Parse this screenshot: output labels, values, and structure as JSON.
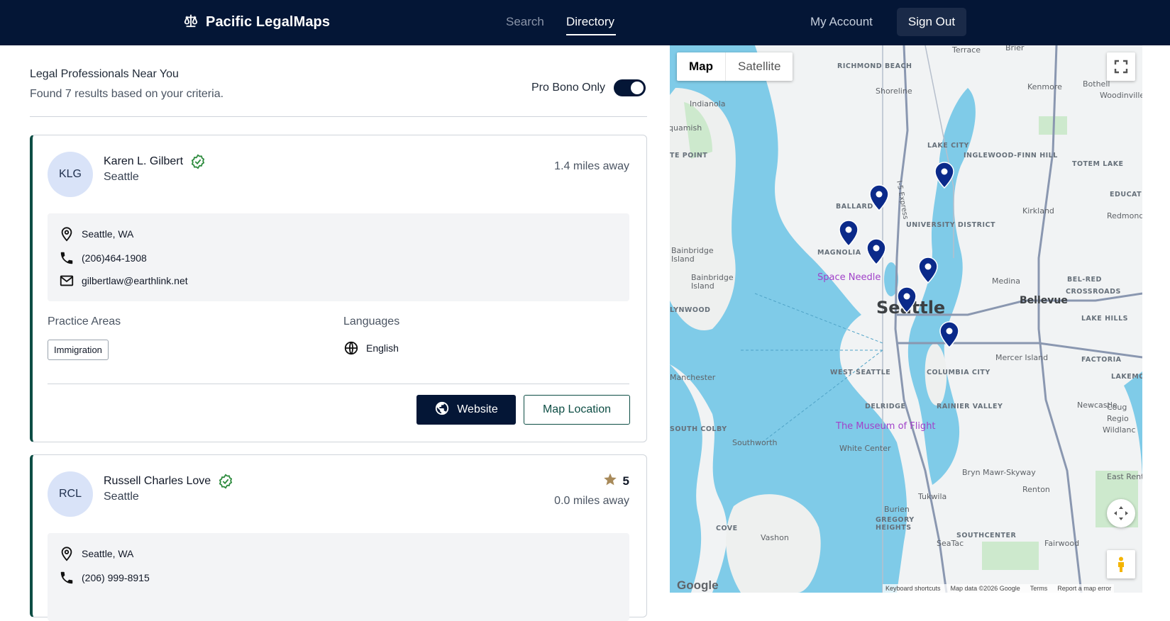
{
  "app": {
    "brand": "Pacific LegalMaps"
  },
  "nav": {
    "search": "Search",
    "directory": "Directory",
    "account": "My Account",
    "sign_out": "Sign Out"
  },
  "results": {
    "title": "Legal Professionals Near You",
    "summary": "Found 7 results based on your criteria.",
    "pro_bono_label": "Pro Bono Only",
    "pro_bono_on": true
  },
  "labels": {
    "practice_areas": "Practice Areas",
    "languages": "Languages",
    "website": "Website",
    "map_location": "Map Location"
  },
  "lawyers": [
    {
      "initials": "KLG",
      "name": "Karen L. Gilbert",
      "city": "Seattle",
      "verified": true,
      "distance": "1.4 miles away",
      "address": "Seattle, WA",
      "phone": "(206)464-1908",
      "email": "gilbertlaw@earthlink.net",
      "practice_areas": [
        "Immigration"
      ],
      "languages": [
        "English"
      ]
    },
    {
      "initials": "RCL",
      "name": "Russell Charles Love",
      "city": "Seattle",
      "verified": true,
      "rating": "5",
      "distance": "0.0 miles away",
      "address": "Seattle, WA",
      "phone": "(206) 999-8915"
    }
  ],
  "map": {
    "type_map": "Map",
    "type_satellite": "Satellite",
    "city_label": "Seattle",
    "labels": {
      "bellevue": "Bellevue",
      "kirkland": "Kirkland",
      "redmond": "Redmond",
      "medina": "Medina",
      "shoreline": "Shoreline",
      "kenmore": "Kenmore",
      "bothell": "Bothell",
      "woodinville": "Woodinville",
      "richmond_beach": "RICHMOND BEACH",
      "brier": "Brier",
      "terrace": "Terrace",
      "indianola": "Indianola",
      "suquamish": "quamish",
      "te_point": "TE POINT",
      "lake_city": "LAKE CITY",
      "inglewood": "INGLEWOOD-FINN HILL",
      "totem_lake": "TOTEM LAKE",
      "education": "EDUCATION",
      "ballard": "BALLARD",
      "university_district": "UNIVERSITY DISTRICT",
      "magnolia": "MAGNOLIA",
      "bainbridge_island_1": "Bainbridge Island",
      "bainbridge_island_2": "Bainbridge Island",
      "space_needle": "Space Needle",
      "bel_red": "BEL-RED",
      "crossroads": "CROSSROADS",
      "lynwood": "LYNWOOD",
      "lake_hills": "LAKE HILLS",
      "mercer_island": "Mercer Island",
      "factoria": "FACTORIA",
      "west_seattle": "WEST SEATTLE",
      "columbia_city": "COLUMBIA CITY",
      "manchester": "Manchester",
      "lakemont": "LAKEMONT",
      "delridge": "DELRIDGE",
      "rainier_valley": "RAINIER VALLEY",
      "newcastle": "Newcastle",
      "museum_of_flight": "The Museum of Flight",
      "south_colby": "SOUTH COLBY",
      "southworth": "Southworth",
      "white_center": "White Center",
      "bryn_mawr": "Bryn Mawr-Skyway",
      "renton": "Renton",
      "east_renton": "East Rento",
      "tukwila": "Tukwila",
      "burien": "Burien",
      "cove": "COVE",
      "vashon": "Vashon",
      "gregory_heights": "GREGORY HEIGHTS",
      "southcenter": "SOUTHCENTER",
      "seatac": "SeaTac",
      "fairwood": "Fairwood",
      "cougar": "Coug",
      "region": "Regio",
      "wildland": "Wildlanc",
      "i5_express": "I-5 Express"
    },
    "footer": {
      "shortcuts": "Keyboard shortcuts",
      "data": "Map data ©2026 Google",
      "terms": "Terms",
      "report": "Report a map error"
    },
    "google": "Google"
  },
  "colors": {
    "navy": "#041636",
    "teal": "#0d4d44",
    "water": "#7fcbe8",
    "pin": "#0b2a8a",
    "verified": "#2e8b3e"
  }
}
